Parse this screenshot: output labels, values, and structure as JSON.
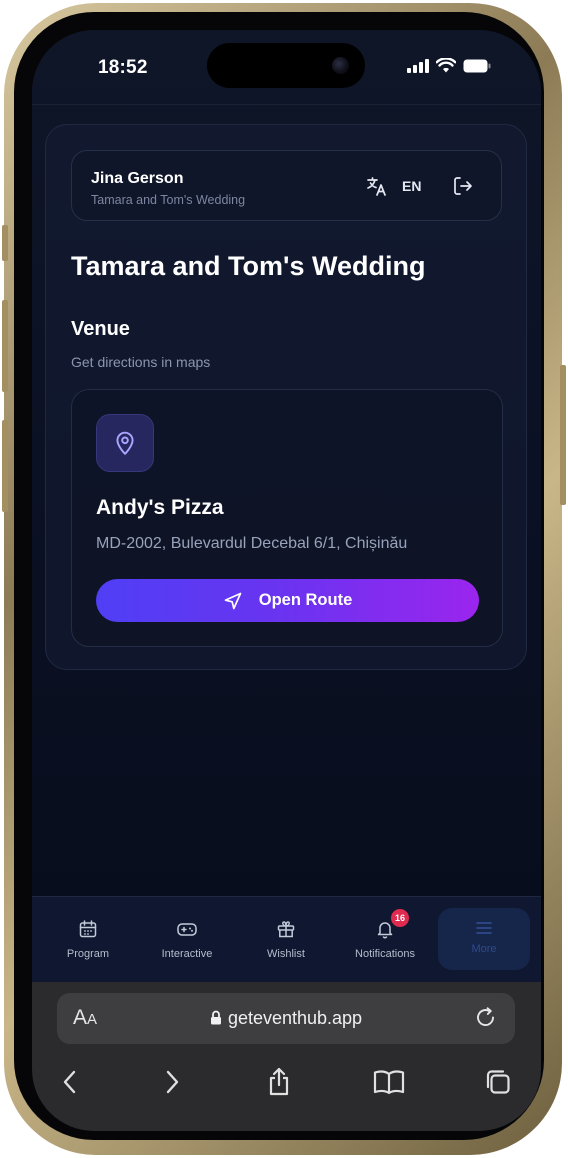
{
  "status_bar": {
    "time": "18:52"
  },
  "user_card": {
    "name": "Jina Gerson",
    "event": "Tamara and Tom's Wedding",
    "language": "EN"
  },
  "page": {
    "title": "Tamara and Tom's Wedding",
    "section_title": "Venue",
    "section_subtitle": "Get directions in maps"
  },
  "venue": {
    "name": "Andy's Pizza",
    "address": "MD-2002, Bulevardul Decebal 6/1, Chișinău",
    "route_label": "Open Route"
  },
  "bottom_nav": {
    "items": [
      {
        "label": "Program",
        "icon": "calendar-icon"
      },
      {
        "label": "Interactive",
        "icon": "gamepad-icon"
      },
      {
        "label": "Wishlist",
        "icon": "gift-icon"
      },
      {
        "label": "Notifications",
        "icon": "bell-icon",
        "badge": "16"
      },
      {
        "label": "More",
        "icon": "menu-icon",
        "active": true
      }
    ]
  },
  "browser": {
    "aa_label_big": "A",
    "aa_label_small": "A",
    "url": "geteventhub.app"
  },
  "colors": {
    "accent_start": "#4f3ff5",
    "accent_end": "#9b25ee",
    "badge": "#e02a4f",
    "background": "#0b1124"
  }
}
